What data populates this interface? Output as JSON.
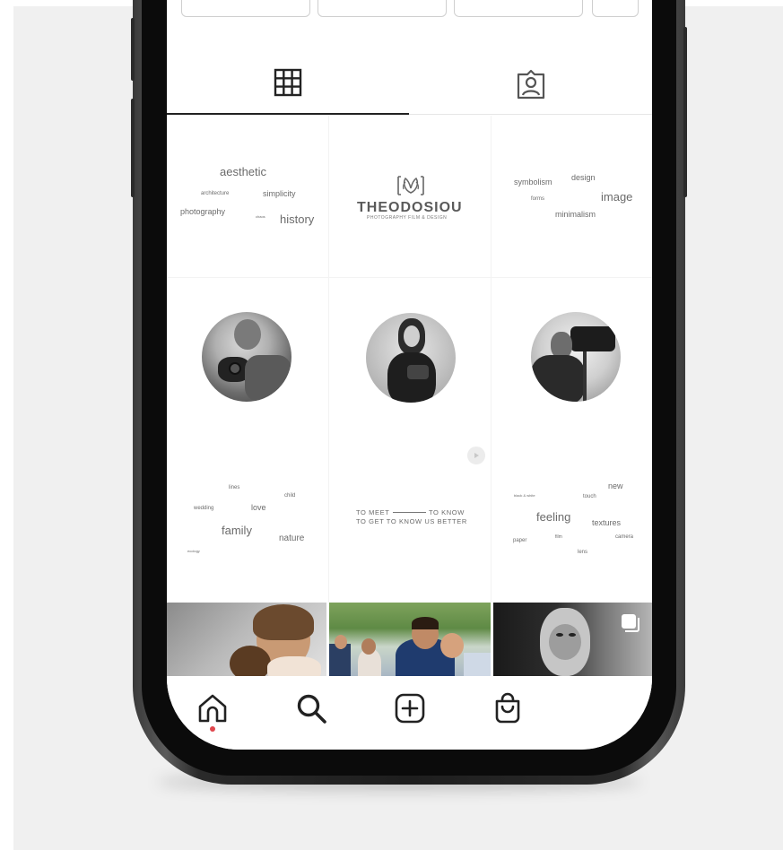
{
  "tabs": {
    "grid_icon": "grid-icon",
    "tagged_icon": "tagged-person-icon"
  },
  "posts": {
    "word_cloud_1": [
      "aesthetic",
      "architecture",
      "simplicity",
      "photography",
      "chaos",
      "history"
    ],
    "logo": {
      "name": "THEODOSIOU",
      "subtitle": "PHOTOGRAPHY FILM & DESIGN"
    },
    "word_cloud_2": [
      "symbolism",
      "design",
      "forms",
      "image",
      "minimalism"
    ],
    "word_cloud_3": [
      "lines",
      "child",
      "wedding",
      "love",
      "family",
      "nature",
      "ecology"
    ],
    "video_text": {
      "line1_left": "TO MEET",
      "line1_right": "TO KNOW",
      "line2": "TO GET TO KNOW US BETTER"
    },
    "word_cloud_4": [
      "new",
      "black & white",
      "touch",
      "feeling",
      "textures",
      "paper",
      "film",
      "camera",
      "lens"
    ]
  },
  "nav": {
    "items": [
      "home-icon",
      "search-icon",
      "add-post-icon",
      "shop-icon"
    ],
    "active_indicator_color": "#e0464d"
  },
  "colors": {
    "text": "#6b6b6b",
    "icon": "#222222",
    "background": "#f0f0f0"
  }
}
